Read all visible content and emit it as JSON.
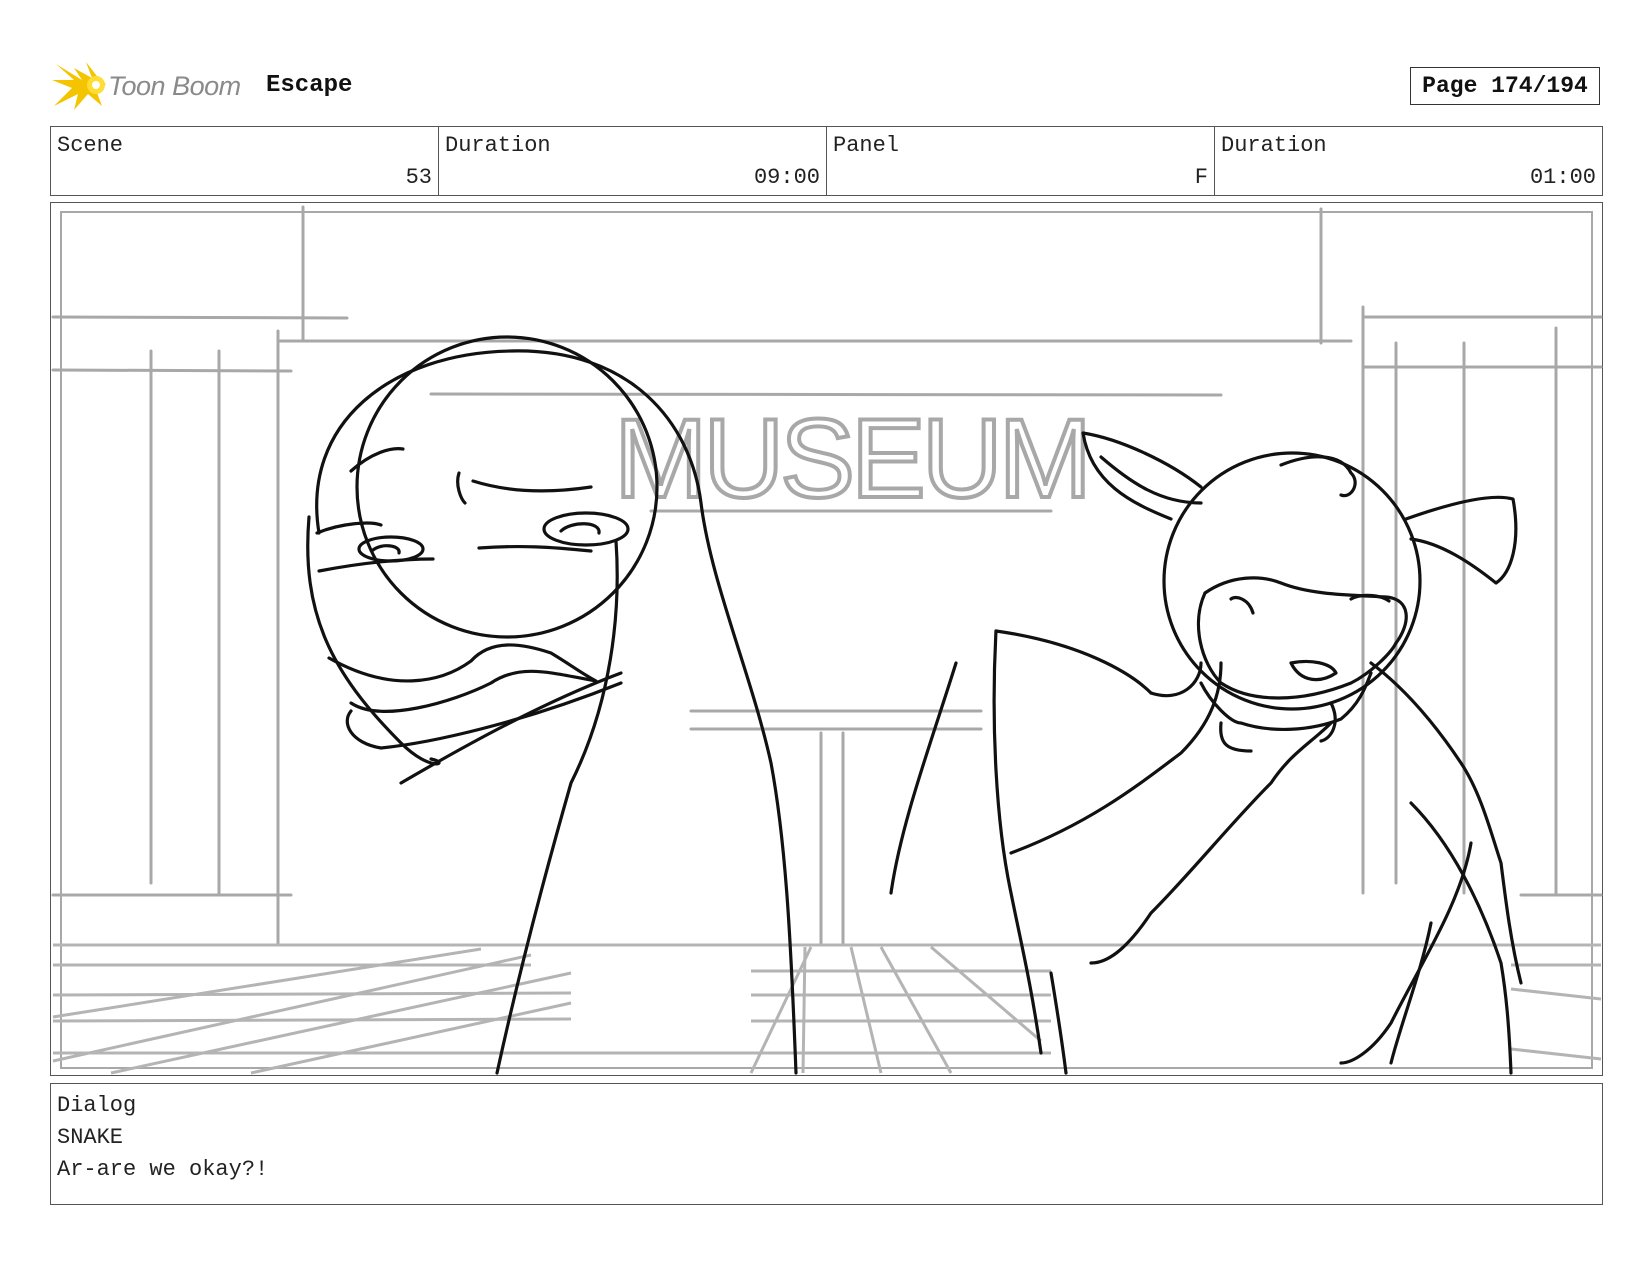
{
  "header": {
    "logo_text": "Toon Boom",
    "project_title": "Escape",
    "page_label": "Page 174/194"
  },
  "info": {
    "scene": {
      "label": "Scene",
      "value": "53"
    },
    "scene_duration": {
      "label": "Duration",
      "value": "09:00"
    },
    "panel": {
      "label": "Panel",
      "value": "F"
    },
    "panel_duration": {
      "label": "Duration",
      "value": "01:00"
    }
  },
  "drawing": {
    "sign_text": "MUSEUM",
    "colors": {
      "background_lines": "#a8a8a8",
      "character_lines": "#111111",
      "logo_accent": "#f5c400"
    }
  },
  "dialog": {
    "label": "Dialog",
    "character": "SNAKE",
    "line": "Ar-are we okay?!"
  }
}
